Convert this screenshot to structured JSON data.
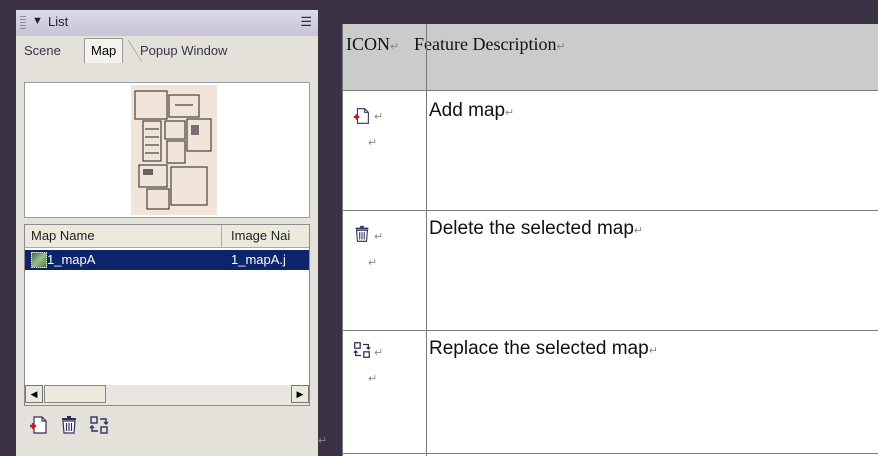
{
  "panel": {
    "title": "List",
    "collapse_glyph": "▼",
    "tabs": [
      "Scene",
      "Map",
      "Popup Window"
    ],
    "active_tab": "Map",
    "list": {
      "columns": [
        "Map Name",
        "Image Nai"
      ],
      "rows": [
        {
          "map_name": "1_mapA",
          "image_name": "1_mapA.j",
          "selected": true
        }
      ]
    },
    "toolbar": [
      "add-map-icon",
      "delete-map-icon",
      "replace-map-icon"
    ]
  },
  "return_mark": "↵",
  "table": {
    "headers": {
      "icon": "ICON",
      "description": "Feature Description"
    },
    "rows": [
      {
        "icon": "add-map-icon",
        "description": "Add map"
      },
      {
        "icon": "delete-map-icon",
        "description": "Delete the selected map"
      },
      {
        "icon": "replace-map-icon",
        "description": "Replace the selected map"
      }
    ]
  },
  "colors": {
    "selection": "#0c246a",
    "header_gray": "#cbcbcb",
    "background": "#3b3245"
  }
}
